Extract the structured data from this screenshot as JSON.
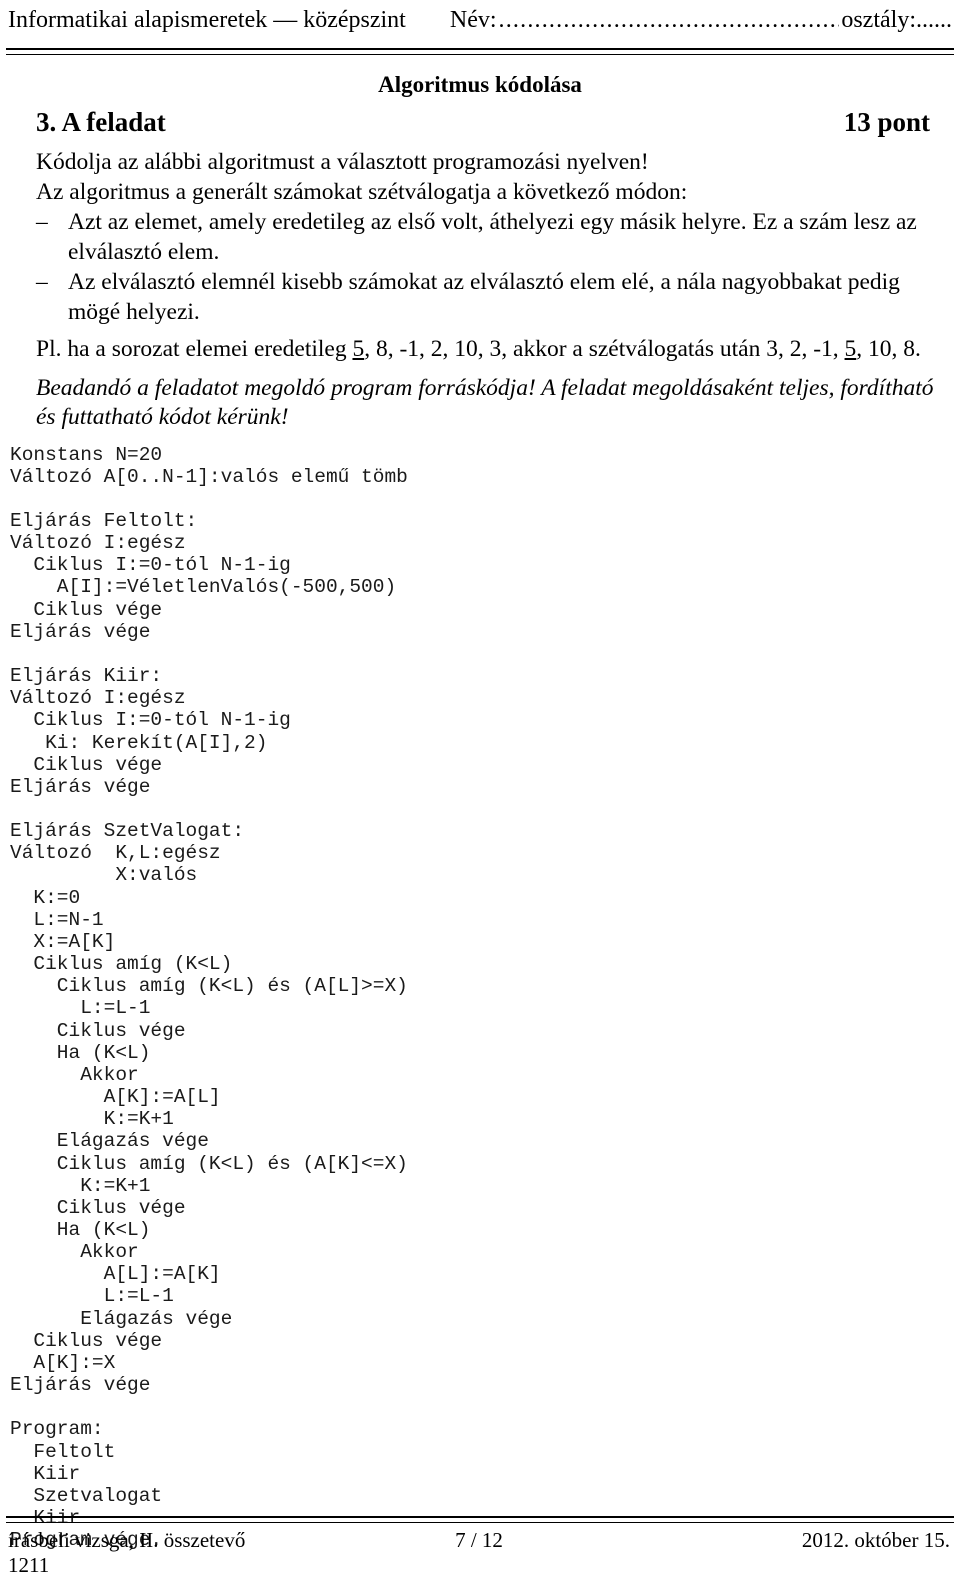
{
  "header": {
    "subject": "Informatikai alapismeretek — középszint",
    "name_label": "Név:",
    "name_dots": "...............................................................",
    "class_label": "osztály:......"
  },
  "title": "Algoritmus kódolása",
  "task": {
    "number_label": "3. A feladat",
    "points_label": "13 pont"
  },
  "body": {
    "intro1": "Kódolja az alábbi algoritmust a választott programozási nyelven!",
    "intro2": "Az algoritmus a generált számokat szétválogatja a következő módon:",
    "bullet_dash": "–",
    "bullet1": "Azt az elemet, amely eredetileg az első volt, áthelyezi egy másik helyre. Ez a szám lesz az elválasztó elem.",
    "bullet2": "Az elválasztó elemnél kisebb számokat az elválasztó elem elé, a nála nagyobbakat pedig mögé helyezi.",
    "example_prefix": "Pl. ha a sorozat elemei eredetileg ",
    "example_seq1_a": "5",
    "example_seq1_b": ", 8, -1, 2, 10, 3, akkor a szétválogatás után 3, 2, -1, ",
    "example_seq2_a": "5",
    "example_seq2_b": ", 10, 8.",
    "note": "Beadandó a feladatot megoldó program forráskódja! A feladat megoldásaként teljes, fordítható és futtatható kódot kérünk!"
  },
  "pseudocode": "Konstans N=20\nVáltozó A[0..N-1]:valós elemű tömb\n\nEljárás Feltolt:\nVáltozó I:egész\n  Ciklus I:=0-tól N-1-ig\n    A[I]:=VéletlenValós(-500,500)\n  Ciklus vége\nEljárás vége\n\nEljárás Kiir:\nVáltozó I:egész\n  Ciklus I:=0-tól N-1-ig\n   Ki: Kerekít(A[I],2)\n  Ciklus vége\nEljárás vége\n\nEljárás SzetValogat:\nVáltozó  K,L:egész\n         X:valós\n  K:=0\n  L:=N-1\n  X:=A[K]\n  Ciklus amíg (K<L)\n    Ciklus amíg (K<L) és (A[L]>=X)\n      L:=L-1\n    Ciklus vége\n    Ha (K<L)\n      Akkor\n        A[K]:=A[L]\n        K:=K+1\n    Elágazás vége\n    Ciklus amíg (K<L) és (A[K]<=X)\n      K:=K+1\n    Ciklus vége\n    Ha (K<L)\n      Akkor\n        A[L]:=A[K]\n        L:=L-1\n      Elágazás vége\n  Ciklus vége\n  A[K]:=X\nEljárás vége\n\nProgram:\n  Feltolt\n  Kiir\n  Szetvalogat\n  Kiir\nProgram vége.",
  "footer": {
    "exam_type": "írásbeli vizsga, II. összetevő",
    "page_number": "7 / 12",
    "date": "2012. október 15.",
    "paper_code": "1211"
  }
}
